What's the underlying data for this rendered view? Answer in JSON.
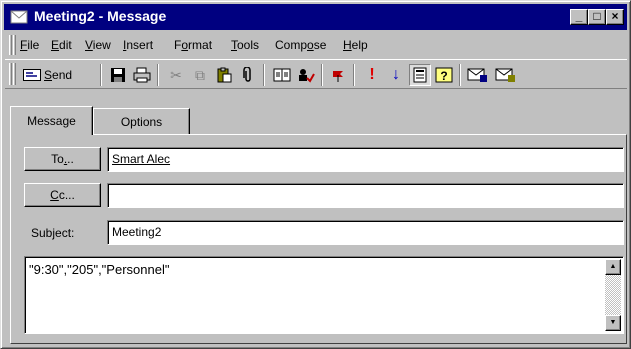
{
  "window": {
    "title": "Meeting2 - Message"
  },
  "caption_buttons": {
    "minimize": "_",
    "maximize": "□",
    "close": "×"
  },
  "menu": {
    "items": [
      {
        "hotkey": "F",
        "rest": "ile"
      },
      {
        "hotkey": "E",
        "rest": "dit"
      },
      {
        "hotkey": "V",
        "rest": "iew"
      },
      {
        "hotkey": "I",
        "rest": "nsert"
      },
      {
        "pre": "F",
        "hotkey": "o",
        "rest": "rmat"
      },
      {
        "hotkey": "T",
        "rest": "ools"
      },
      {
        "pre": "Comp",
        "hotkey": "o",
        "rest": "se"
      },
      {
        "hotkey": "H",
        "rest": "elp"
      }
    ]
  },
  "toolbar": {
    "send": {
      "pre": "",
      "hotkey": "S",
      "rest": "end"
    },
    "icons": {
      "save": "💾",
      "print": "🖶",
      "cut": "✂",
      "copy": "⧉",
      "paste": "📋",
      "attach": "📎",
      "address_book": "📖",
      "check_names": "✓",
      "flag": "⚑",
      "high_importance": "!",
      "low_importance": "↓",
      "options": "▤",
      "help": "?",
      "sign": "✉",
      "encrypt": "✉"
    }
  },
  "tabs": {
    "message": "Message",
    "options": "Options"
  },
  "fields": {
    "to": {
      "btn_pre": "To",
      "btn_hotkey": ".",
      "btn_rest": "..",
      "value": "Smart Alec"
    },
    "cc": {
      "btn_pre": "",
      "btn_hotkey": "C",
      "btn_rest": "c...",
      "value": ""
    },
    "subject": {
      "label": "Subject:",
      "value": "Meeting2"
    }
  },
  "body": {
    "text": "\"9:30\",\"205\",\"Personnel\""
  },
  "scroll": {
    "up": "▲",
    "down": "▼"
  },
  "colors": {
    "titlebar": "#000080",
    "flag": "#c00000",
    "high_importance": "#e00000",
    "low_importance": "#0000c0"
  }
}
